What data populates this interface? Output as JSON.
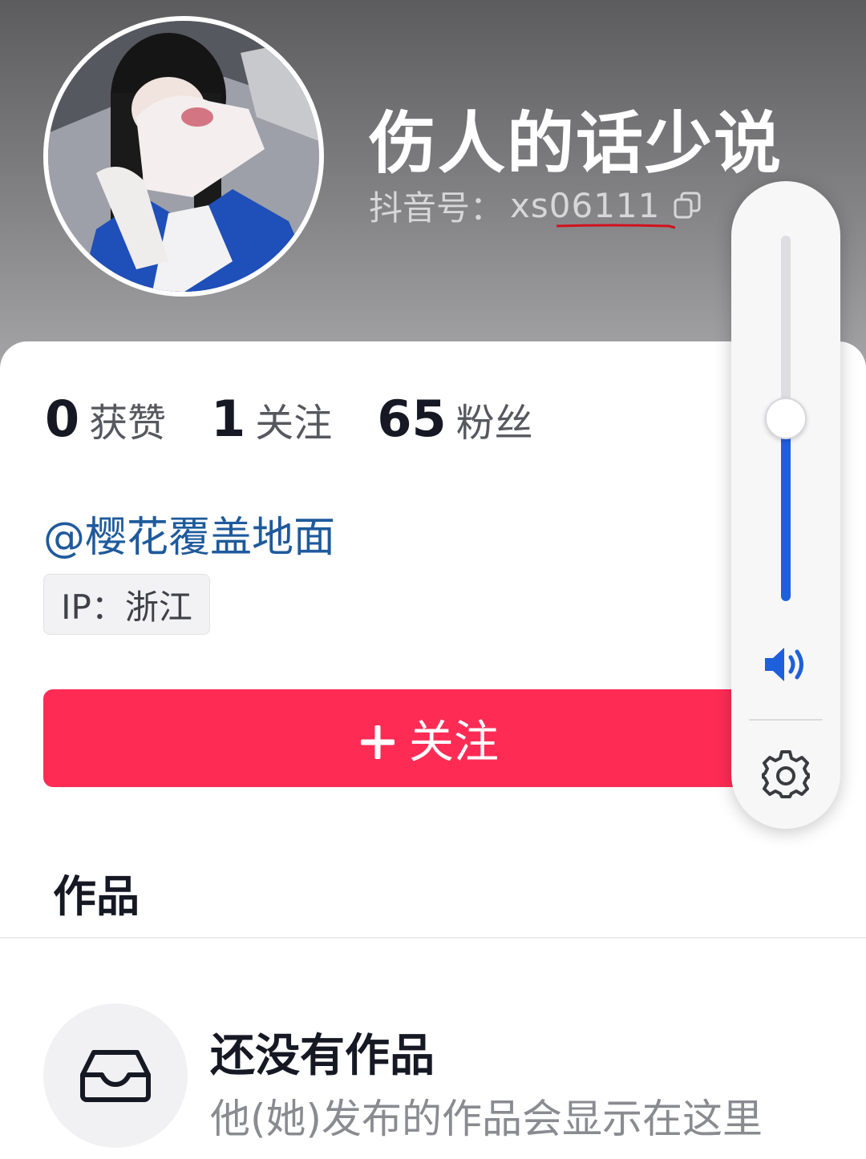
{
  "profile": {
    "nickname": "伤人的话少说",
    "id_label": "抖音号：",
    "id_value": "xs06111",
    "avatar_icon": "user-avatar-photo",
    "copy_icon": "copy-icon"
  },
  "stats": [
    {
      "value": "0",
      "label": "获赞"
    },
    {
      "value": "1",
      "label": "关注"
    },
    {
      "value": "65",
      "label": "粉丝"
    }
  ],
  "bio": {
    "mention": "@樱花覆盖地面",
    "ip_tag": "IP：浙江"
  },
  "follow_button": {
    "label": "关注",
    "icon": "plus-icon",
    "color": "#fe2c55"
  },
  "works": {
    "title": "作品",
    "empty_title": "还没有作品",
    "empty_subtitle": "他(她)发布的作品会显示在这里",
    "empty_icon": "inbox-tray-icon"
  },
  "volume_overlay": {
    "level": 0.5,
    "accent_color": "#1e5fdc",
    "speaker_icon": "speaker-volume-icon",
    "settings_icon": "gear-icon"
  }
}
